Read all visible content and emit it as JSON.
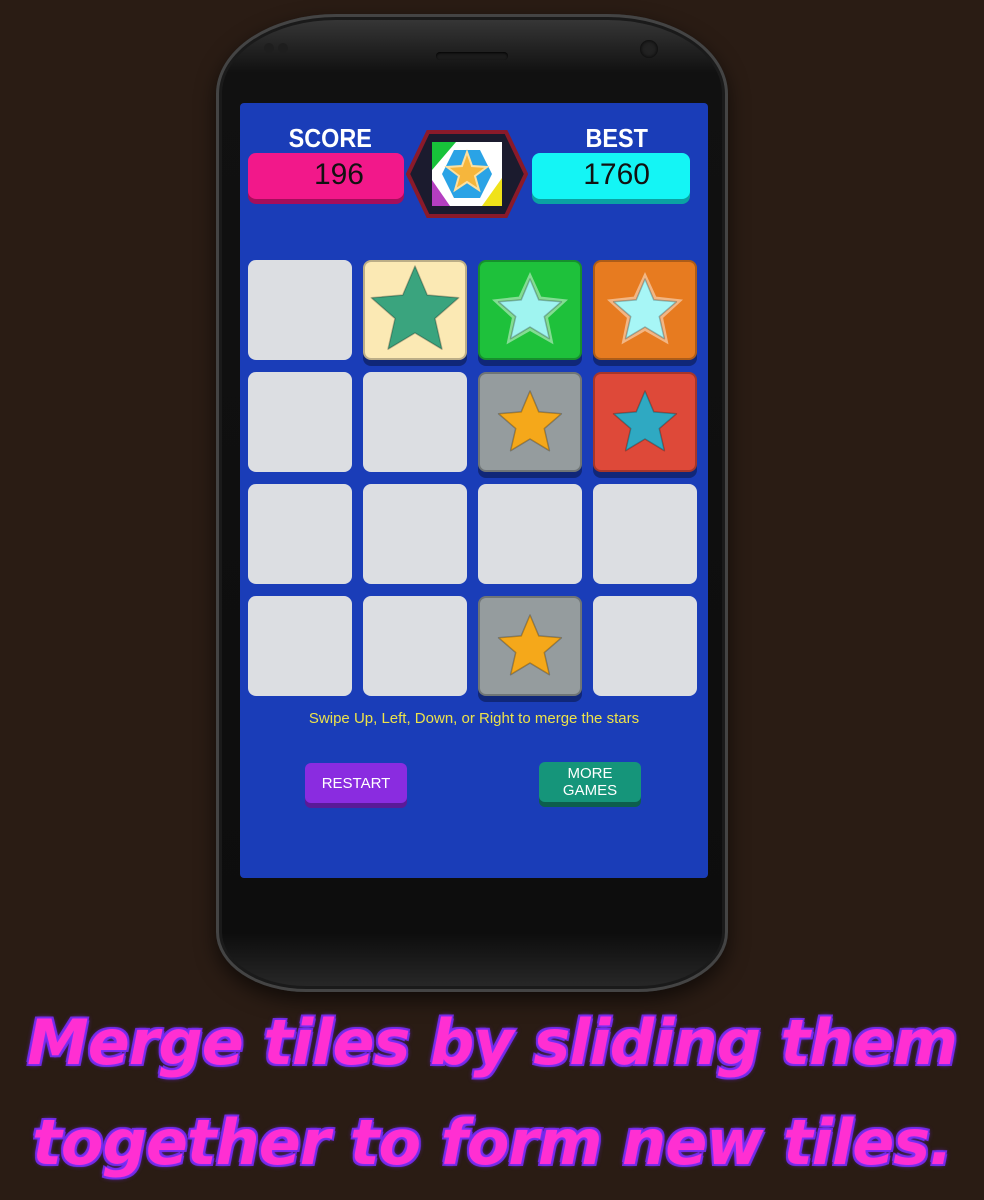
{
  "header": {
    "score_label": "SCORE",
    "score_value": "196",
    "best_label": "BEST",
    "best_value": "1760"
  },
  "board": {
    "rows": 4,
    "cols": 4,
    "tiles": [
      [
        null,
        {
          "bg": "#fbe9b4",
          "star": "#3aa47e",
          "style": "plain"
        },
        {
          "bg": "#1ec13b",
          "star": "#9ff4f0",
          "style": "glow"
        },
        {
          "bg": "#e77b20",
          "star": "#a7f6f6",
          "style": "glow"
        }
      ],
      [
        null,
        null,
        {
          "bg": "#959c9e",
          "star": "#f5a81a",
          "style": "plain"
        },
        {
          "bg": "#de4939",
          "star": "#2fa9c2",
          "style": "plain"
        }
      ],
      [
        null,
        null,
        null,
        null
      ],
      [
        null,
        null,
        {
          "bg": "#959c9e",
          "star": "#f5a81a",
          "style": "plain"
        },
        null
      ]
    ]
  },
  "hint": "Swipe Up, Left, Down, or Right to merge the stars",
  "buttons": {
    "restart": "RESTART",
    "more_line1": "MORE",
    "more_line2": "GAMES"
  },
  "caption": {
    "line1": "Merge tiles by sliding them",
    "line2": "together to form new tiles."
  },
  "colors": {
    "background": "#2a1c14",
    "screen": "#1a3db8",
    "score_box": "#f2188a",
    "best_box": "#14f5f5",
    "empty_tile": "#dcdee2",
    "caption_fill": "#ff2fd2"
  }
}
